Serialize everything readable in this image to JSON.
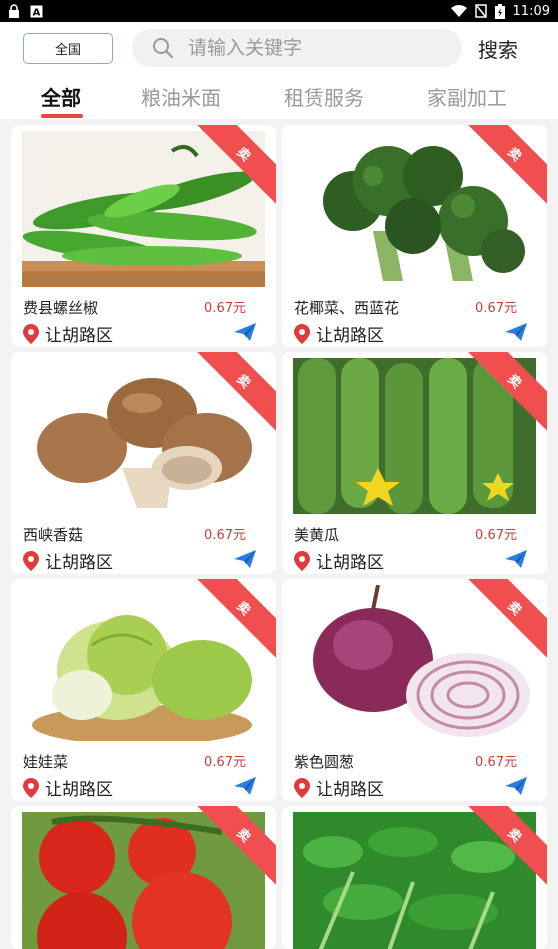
{
  "status_bar": {
    "time": "11:09"
  },
  "header": {
    "region_label": "全国",
    "search_placeholder": "请输入关键字",
    "search_button": "搜索"
  },
  "tabs": [
    {
      "label": "全部",
      "active": true
    },
    {
      "label": "粮油米面",
      "active": false
    },
    {
      "label": "租赁服务",
      "active": false
    },
    {
      "label": "家副加工",
      "active": false
    }
  ],
  "products": [
    {
      "name": "费县螺丝椒",
      "price": "0.67元",
      "location": "让胡路区",
      "badge": "卖",
      "image": "green-pepper"
    },
    {
      "name": "花椰菜、西蓝花",
      "price": "0.67元",
      "location": "让胡路区",
      "badge": "卖",
      "image": "broccoli"
    },
    {
      "name": "西峡香菇",
      "price": "0.67元",
      "location": "让胡路区",
      "badge": "卖",
      "image": "mushroom"
    },
    {
      "name": "美黄瓜",
      "price": "0.67元",
      "location": "让胡路区",
      "badge": "卖",
      "image": "cucumber"
    },
    {
      "name": "娃娃菜",
      "price": "0.67元",
      "location": "让胡路区",
      "badge": "卖",
      "image": "napa-cabbage"
    },
    {
      "name": "紫色圆葱",
      "price": "0.67元",
      "location": "让胡路区",
      "badge": "卖",
      "image": "red-onion"
    },
    {
      "name": "",
      "price": "",
      "location": "",
      "badge": "卖",
      "image": "tomato"
    },
    {
      "name": "",
      "price": "",
      "location": "",
      "badge": "卖",
      "image": "leafy-greens"
    }
  ],
  "colors": {
    "accent_red": "#e64646",
    "ribbon": "#f14f4f",
    "price": "#d23c3c",
    "send": "#2a7de1",
    "pin": "#e03a3a"
  }
}
